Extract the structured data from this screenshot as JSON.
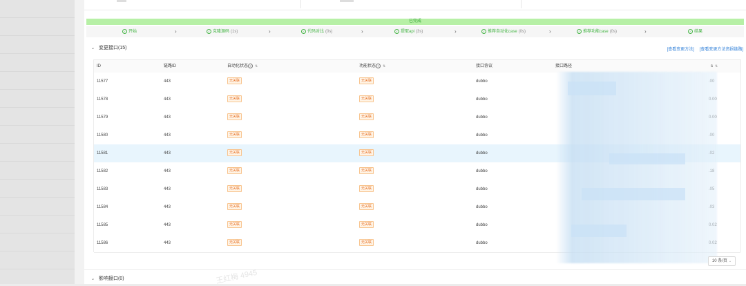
{
  "progress": {
    "status": "已完成",
    "steps": [
      {
        "label": "开始",
        "duration": ""
      },
      {
        "label": "克隆源码",
        "duration": "(1s)"
      },
      {
        "label": "代码对比",
        "duration": "(0s)"
      },
      {
        "label": "提取api",
        "duration": "(3s)"
      },
      {
        "label": "推荐自动化case",
        "duration": "(0s)"
      },
      {
        "label": "推荐功能case",
        "duration": "(0s)"
      },
      {
        "label": "结果",
        "duration": ""
      }
    ]
  },
  "changed_section": {
    "title": "变更接口(15)",
    "link_methods": "[查看变更方法]",
    "link_links": "[查看变更方法资损链路]"
  },
  "table": {
    "columns": {
      "id": "ID",
      "chain_id": "链路ID",
      "auto_status": "自动化状态",
      "func_status": "功能状态",
      "protocol": "接口协议",
      "path": "接口路径",
      "last": "s"
    },
    "rows": [
      {
        "id": "11577",
        "chain_id": "443",
        "auto_status": "无关联",
        "func_status": "无关联",
        "protocol": "dubbo",
        "last": ".00"
      },
      {
        "id": "11578",
        "chain_id": "443",
        "auto_status": "无关联",
        "func_status": "无关联",
        "protocol": "dubbo",
        "last": "0.00"
      },
      {
        "id": "11579",
        "chain_id": "443",
        "auto_status": "无关联",
        "func_status": "无关联",
        "protocol": "dubbo",
        "last": "0.00"
      },
      {
        "id": "11580",
        "chain_id": "443",
        "auto_status": "无关联",
        "func_status": "无关联",
        "protocol": "dubbo",
        "last": ".00"
      },
      {
        "id": "11581",
        "chain_id": "443",
        "auto_status": "无关联",
        "func_status": "无关联",
        "protocol": "dubbo",
        "last": ".02"
      },
      {
        "id": "11582",
        "chain_id": "443",
        "auto_status": "无关联",
        "func_status": "无关联",
        "protocol": "dubbo",
        "last": ".18"
      },
      {
        "id": "11583",
        "chain_id": "443",
        "auto_status": "无关联",
        "func_status": "无关联",
        "protocol": "dubbo",
        "last": ".05"
      },
      {
        "id": "11584",
        "chain_id": "443",
        "auto_status": "无关联",
        "func_status": "无关联",
        "protocol": "dubbo",
        "last": ".03"
      },
      {
        "id": "11585",
        "chain_id": "443",
        "auto_status": "无关联",
        "func_status": "无关联",
        "protocol": "dubbo",
        "last": "0.02"
      },
      {
        "id": "11586",
        "chain_id": "443",
        "auto_status": "无关联",
        "func_status": "无关联",
        "protocol": "dubbo",
        "last": "0.02"
      }
    ],
    "highlighted_row": 4
  },
  "pager": {
    "page_size": "10 条/页"
  },
  "affected_section": {
    "title": "影响接口(0)"
  },
  "watermark": "王红梅 4945",
  "colors": {
    "success": "#46b546",
    "done_bar": "#b7f0a6",
    "link": "#2f7fd8",
    "tag_text": "#e8742a"
  }
}
